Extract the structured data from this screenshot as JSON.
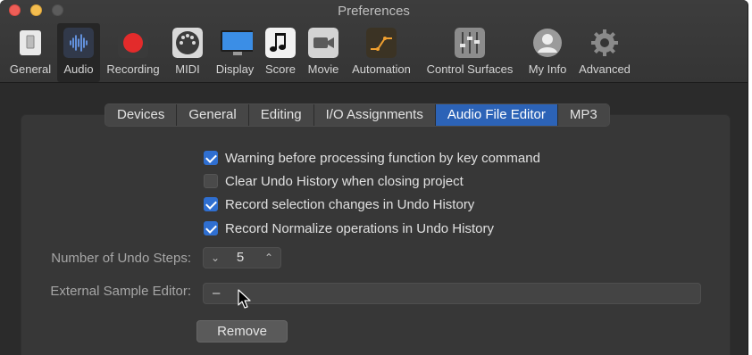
{
  "window": {
    "title": "Preferences"
  },
  "toolbar": {
    "items": [
      {
        "label": "General",
        "icon": "general-icon"
      },
      {
        "label": "Audio",
        "icon": "audio-waveform-icon",
        "selected": true
      },
      {
        "label": "Recording",
        "icon": "record-icon"
      },
      {
        "label": "MIDI",
        "icon": "midi-icon"
      },
      {
        "label": "Display",
        "icon": "display-icon"
      },
      {
        "label": "Score",
        "icon": "score-icon"
      },
      {
        "label": "Movie",
        "icon": "movie-camera-icon"
      },
      {
        "label": "Automation",
        "icon": "automation-icon"
      },
      {
        "label": "Control Surfaces",
        "icon": "control-surfaces-icon"
      },
      {
        "label": "My Info",
        "icon": "user-icon"
      },
      {
        "label": "Advanced",
        "icon": "gear-icon"
      }
    ]
  },
  "tabs": [
    {
      "label": "Devices"
    },
    {
      "label": "General"
    },
    {
      "label": "Editing"
    },
    {
      "label": "I/O Assignments"
    },
    {
      "label": "Audio File Editor",
      "active": true
    },
    {
      "label": "MP3"
    }
  ],
  "options": [
    {
      "label": "Warning before processing function by key command",
      "checked": true
    },
    {
      "label": "Clear Undo History when closing project",
      "checked": false
    },
    {
      "label": "Record selection changes in Undo History",
      "checked": true
    },
    {
      "label": "Record Normalize operations in Undo History",
      "checked": true
    }
  ],
  "undo_steps": {
    "label": "Number of Undo Steps:",
    "value": "5"
  },
  "external_editor": {
    "label": "External Sample Editor:",
    "value": "–"
  },
  "remove_button": {
    "label": "Remove"
  },
  "colors": {
    "accent": "#2c63b7",
    "checkbox": "#2f6fd1"
  }
}
